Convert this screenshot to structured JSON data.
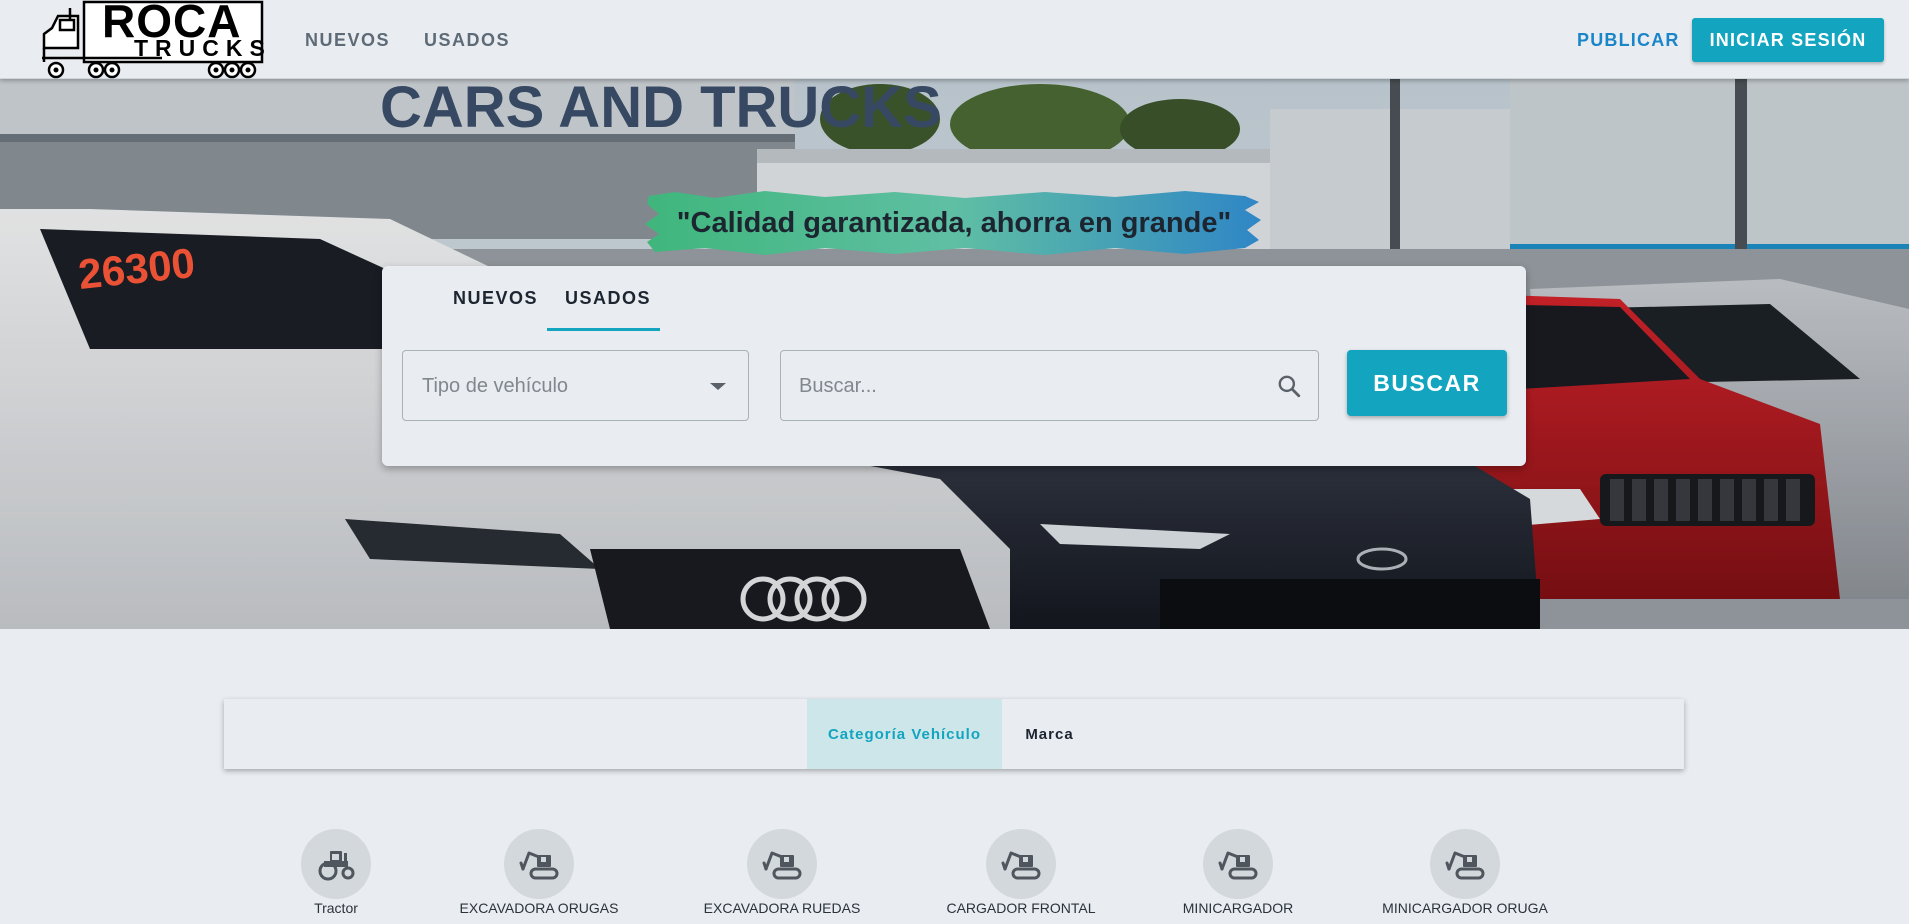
{
  "header": {
    "logo_line1": "ROCA",
    "logo_line2": "TRUCKS",
    "nav": [
      {
        "label": "NUEVOS"
      },
      {
        "label": "USADOS"
      }
    ],
    "publish_label": "PUBLICAR",
    "login_label": "INICIAR SESIÓN"
  },
  "hero": {
    "slogan": "\"Calidad garantizada, ahorra en grande\"",
    "price_sign": "26300",
    "building_sign": "CARS AND TRUCKS"
  },
  "search": {
    "tabs": [
      {
        "label": "NUEVOS",
        "active": false
      },
      {
        "label": "USADOS",
        "active": true
      }
    ],
    "vehicle_type_placeholder": "Tipo de vehículo",
    "query_placeholder": "Buscar...",
    "submit_label": "BUSCAR"
  },
  "filters": {
    "tabs": [
      {
        "label": "Categoría Vehículo",
        "active": true
      },
      {
        "label": "Marca",
        "active": false
      }
    ]
  },
  "categories": [
    {
      "label": "Tractor",
      "icon": "tractor-icon"
    },
    {
      "label": "EXCAVADORA ORUGAS",
      "icon": "excavator-icon"
    },
    {
      "label": "EXCAVADORA RUEDAS",
      "icon": "excavator-icon"
    },
    {
      "label": "CARGADOR FRONTAL",
      "icon": "excavator-icon"
    },
    {
      "label": "MINICARGADOR",
      "icon": "excavator-icon"
    },
    {
      "label": "MINICARGADOR ORUGA",
      "icon": "excavator-icon"
    }
  ],
  "colors": {
    "accent": "#13a5bf",
    "link": "#1a86c9",
    "background": "#e9edf1"
  }
}
